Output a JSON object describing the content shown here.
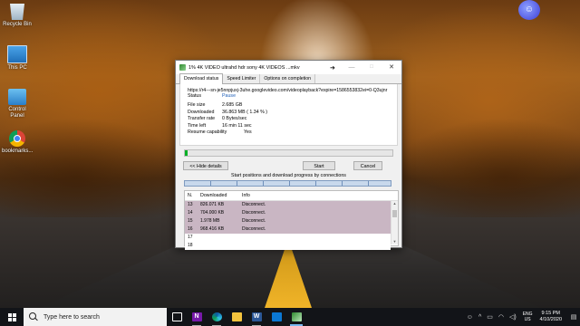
{
  "desktop": {
    "icons": [
      {
        "label": "Recycle Bin"
      },
      {
        "label": "This PC"
      },
      {
        "label": "Control Panel"
      },
      {
        "label": "bookmarks..."
      }
    ]
  },
  "idm_window": {
    "title": "1% 4K VIDEO ultrahd hdr sony 4K VIDEOS ...mkv",
    "buttons": {
      "minimize": "—",
      "maximize": "□",
      "close": "✕"
    },
    "tabs": [
      "Download status",
      "Speed Limiter",
      "Options on completion"
    ],
    "url": "https://r4---sn-je5nnpjuxj-3uhe.googlevideo.com/videoplayback?expire=1586553832ei=0-Q3ujnr",
    "status": {
      "label": "Status",
      "value": "Pause"
    },
    "fields": [
      {
        "label": "File size",
        "value": "2.685  GB"
      },
      {
        "label": "Downloaded",
        "value": "36.863  MB  ( 1.34 % )"
      },
      {
        "label": "Transfer rate",
        "value": "0  Bytes/sec"
      },
      {
        "label": "Time left",
        "value": "16 min 11 sec"
      },
      {
        "label": "Resume capability",
        "value": "Yes"
      }
    ],
    "progress": 1.34,
    "progress_color": "#06b025",
    "actions": {
      "hide_details": "<< Hide details",
      "start": "Start",
      "cancel": "Cancel"
    },
    "connections_label": "Start positions and download progress by connections",
    "table": {
      "headers": [
        "N.",
        "Downloaded",
        "Info"
      ],
      "rows": [
        {
          "n": "13",
          "downloaded": "826.071  KB",
          "info": "Disconnect."
        },
        {
          "n": "14",
          "downloaded": "704.000  KB",
          "info": "Disconnect."
        },
        {
          "n": "15",
          "downloaded": "1.978  MB",
          "info": "Disconnect."
        },
        {
          "n": "16",
          "downloaded": "968.416  KB",
          "info": "Disconnect."
        },
        {
          "n": "17",
          "downloaded": "",
          "info": ""
        },
        {
          "n": "18",
          "downloaded": "",
          "info": ""
        }
      ],
      "row_highlight_color": "#c9b6c3"
    }
  },
  "taskbar": {
    "search_placeholder": "Type here to search",
    "icons": [
      "task-view-icon",
      "onenote-icon",
      "edge-icon",
      "file-explorer-icon",
      "word-icon",
      "photos-icon",
      "idm-icon"
    ],
    "language": {
      "line1": "ENG",
      "line2": "US"
    },
    "clock": {
      "time": "9:15 PM",
      "date": "4/10/2020"
    }
  }
}
